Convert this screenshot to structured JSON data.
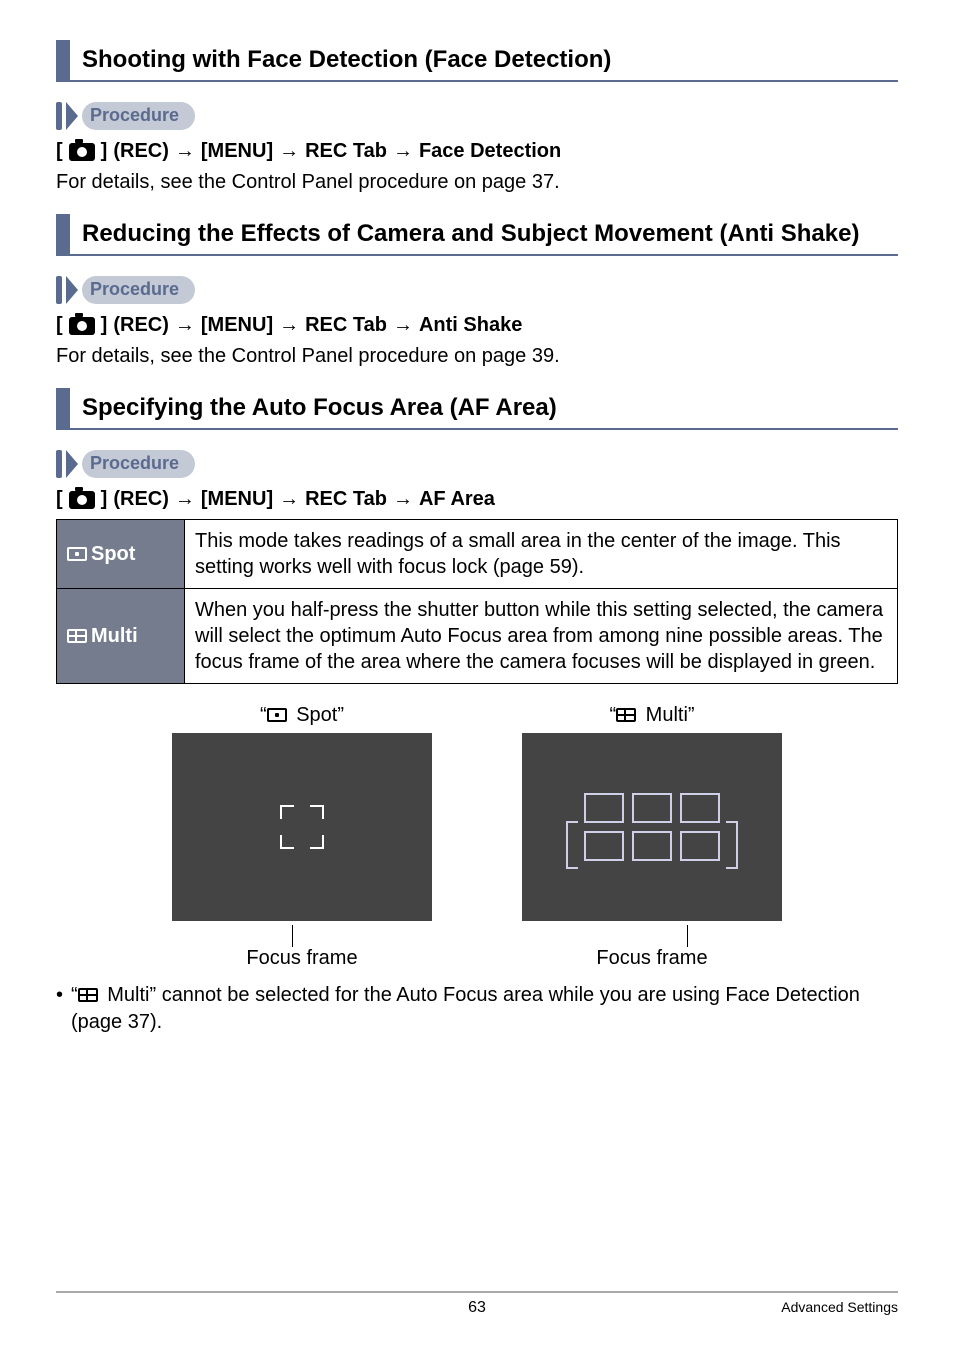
{
  "sections": {
    "face": {
      "title": "Shooting with Face Detection (Face Detection)",
      "proc_label": "Procedure",
      "path_parts": [
        "(REC)",
        "[MENU]",
        "REC Tab",
        "Face Detection"
      ],
      "body": "For details, see the Control Panel procedure on page 37."
    },
    "anti": {
      "title": "Reducing the Effects of Camera and Subject Movement (Anti Shake)",
      "proc_label": "Procedure",
      "path_parts": [
        "(REC)",
        "[MENU]",
        "REC Tab",
        "Anti Shake"
      ],
      "body": "For details, see the Control Panel procedure on page 39."
    },
    "af": {
      "title": "Specifying the Auto Focus Area (AF Area)",
      "proc_label": "Procedure",
      "path_parts": [
        "(REC)",
        "[MENU]",
        "REC Tab",
        "AF Area"
      ],
      "table": {
        "spot_label": "Spot",
        "spot_desc": "This mode takes readings of a small area in the center of the image. This setting works well with focus lock (page 59).",
        "multi_label": "Multi",
        "multi_desc": "When you half-press the shutter button while this setting selected, the camera will select the optimum Auto Focus area from among nine possible areas. The focus frame of the area where the camera focuses will be displayed in green."
      },
      "previews": {
        "spot_caption_prefix": "“",
        "spot_caption_suffix": " Spot”",
        "multi_caption_prefix": "“",
        "multi_caption_suffix": " Multi”",
        "focus_label": "Focus frame"
      },
      "note_prefix": "“",
      "note_after_icon": " Multi” cannot be selected for the Auto Focus area while you are using Face Detection (page 37)."
    }
  },
  "footer": {
    "page": "63",
    "section": "Advanced Settings"
  }
}
